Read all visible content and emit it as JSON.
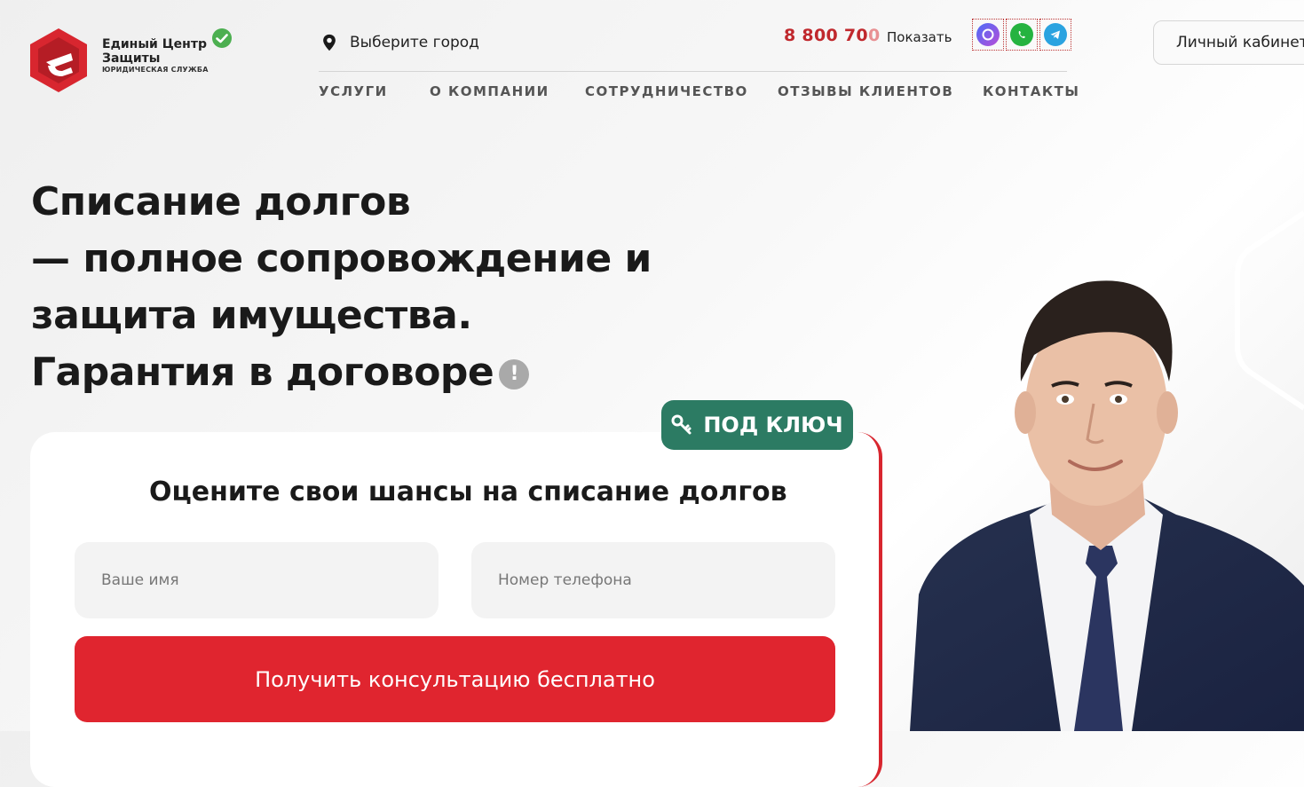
{
  "header": {
    "brand_line1": "Единый Центр",
    "brand_line2": "Защиты",
    "brand_sub": "ЮРИДИЧЕСКАЯ СЛУЖБА",
    "city_label": "Выберите город",
    "phone_visible": "8 800 70",
    "phone_fade": "0",
    "show_label": "Показать",
    "messengers": [
      "max-icon",
      "whatsapp-icon",
      "telegram-icon"
    ],
    "cabinet_label": "Личный кабинет"
  },
  "nav": {
    "items": [
      "УСЛУГИ",
      "О КОМПАНИИ",
      "СОТРУДНИЧЕСТВО",
      "ОТЗЫВЫ КЛИЕНТОВ",
      "КОНТАКТЫ"
    ]
  },
  "hero": {
    "line1": "Списание долгов",
    "line2": "— полное сопровождение и",
    "line3": "защита имущества.",
    "line4": "Гарантия в договоре",
    "info_symbol": "!"
  },
  "badge": {
    "label": "ПОД КЛЮЧ",
    "icon": "key-icon"
  },
  "form": {
    "title": "Оцените свои шансы на списание долгов",
    "name_placeholder": "Ваше имя",
    "phone_placeholder": "Номер телефона",
    "submit_label": "Получить консультацию бесплатно"
  },
  "colors": {
    "accent_red": "#e0252f",
    "phone_red": "#c0282d",
    "badge_green": "#2c7b63",
    "verified_green": "#4caf50"
  }
}
